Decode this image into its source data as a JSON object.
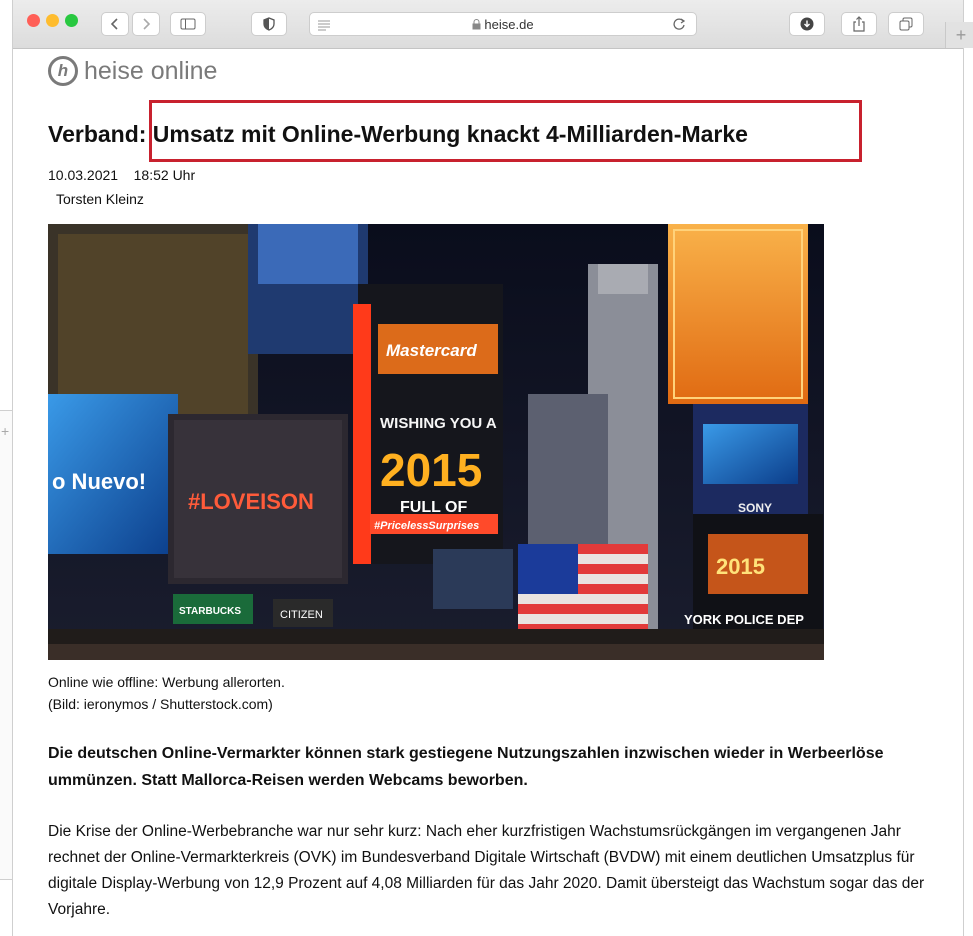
{
  "browser": {
    "address": "heise.de",
    "lock_icon": "lock-icon",
    "colors": {
      "close": "#ff5f57",
      "minimize": "#febc2e",
      "zoom": "#28c840"
    },
    "new_tab_symbol": "+"
  },
  "site": {
    "logo_letter": "h",
    "logo_text": "heise online"
  },
  "article": {
    "headline": "Verband: Umsatz mit Online-Werbung knackt 4-Milliarden-Marke",
    "date": "10.03.2021",
    "time": "18:52 Uhr",
    "author": "Torsten Kleinz",
    "image_texts": {
      "mastercard": "Mastercard",
      "wishing": "WISHING YOU A",
      "year": "2015",
      "full_of": "FULL OF",
      "priceless": "#PricelessSurprises",
      "loveison": "#LOVEISON",
      "nuevo": "o Nuevo!",
      "sony": "SONY",
      "citizen": "CITIZEN",
      "starbucks": "STARBUCKS",
      "police": "YORK POLICE DEP",
      "year2": "2015"
    },
    "caption_line1": "Online wie offline: Werbung allerorten.",
    "caption_line2": "(Bild: ieronymos / Shutterstock.com)",
    "lead": "Die deutschen Online-Vermarkter können stark gestiegene Nutzungszahlen inzwischen wieder in Werbeerlöse ummünzen. Statt Mallorca-Reisen werden Webcams beworben.",
    "body": "Die Krise der Online-Werbebranche war nur sehr kurz: Nach eher kurzfristigen Wachstumsrückgängen im vergangenen Jahr rechnet der Online-Vermarkterkreis (OVK) im Bundesverband Digitale Wirtschaft (BVDW) mit einem deutlichen Umsatzplus für digitale Display-Werbung von 12,9 Prozent auf 4,08 Milliarden für das Jahr 2020. Damit übersteigt das Wachstum sogar das der Vorjahre."
  },
  "highlight_color": "#c8212e"
}
